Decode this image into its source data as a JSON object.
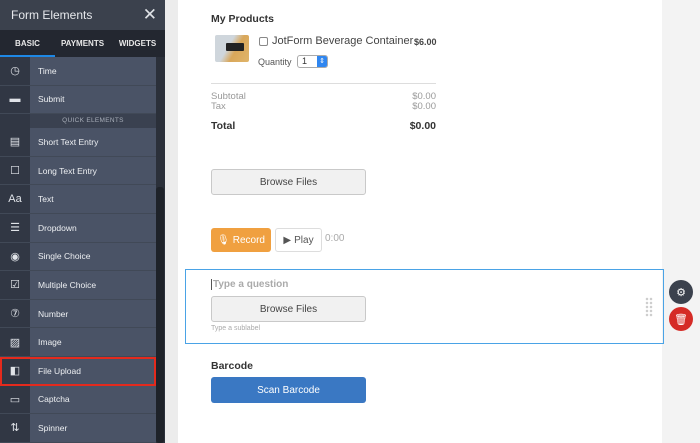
{
  "sidebar": {
    "title": "Form Elements",
    "tabs": [
      "BASIC",
      "PAYMENTS",
      "WIDGETS"
    ],
    "items_top": [
      {
        "label": "Time",
        "icon": "clock-icon"
      },
      {
        "label": "Submit",
        "icon": "submit-icon"
      }
    ],
    "section": "QUICK ELEMENTS",
    "items": [
      {
        "label": "Short Text Entry",
        "icon": "short-text-icon"
      },
      {
        "label": "Long Text Entry",
        "icon": "long-text-icon"
      },
      {
        "label": "Text",
        "icon": "text-icon"
      },
      {
        "label": "Dropdown",
        "icon": "dropdown-icon"
      },
      {
        "label": "Single Choice",
        "icon": "radio-icon"
      },
      {
        "label": "Multiple Choice",
        "icon": "checkbox-icon"
      },
      {
        "label": "Number",
        "icon": "number-icon"
      },
      {
        "label": "Image",
        "icon": "image-icon"
      },
      {
        "label": "File Upload",
        "icon": "file-upload-icon"
      },
      {
        "label": "Captcha",
        "icon": "captcha-icon"
      },
      {
        "label": "Spinner",
        "icon": "spinner-icon"
      }
    ]
  },
  "products": {
    "title": "My Products",
    "name": "JotForm Beverage Container",
    "price": "$6.00",
    "quantity_label": "Quantity",
    "quantity": "1",
    "subtotal_label": "Subtotal",
    "subtotal": "$0.00",
    "tax_label": "Tax",
    "tax": "$0.00",
    "total_label": "Total",
    "total": "$0.00"
  },
  "upload1": {
    "button": "Browse Files"
  },
  "voice": {
    "record": "Record",
    "play": "Play",
    "time": "0:00"
  },
  "upload2": {
    "question": "Type a question",
    "button": "Browse Files",
    "sublabel": "Type a sublabel"
  },
  "barcode": {
    "label": "Barcode",
    "button": "Scan Barcode"
  },
  "colors": {
    "accent": "#1e88e5",
    "record": "#f0a040",
    "scan": "#3a78c3",
    "delete": "#d52b26",
    "selected": "#e42a1d"
  }
}
